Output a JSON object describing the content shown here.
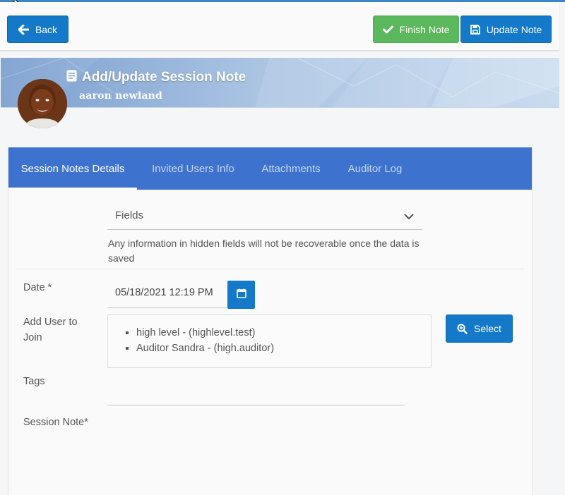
{
  "toolbar": {
    "back_label": "Back",
    "finish_label": "Finish Note",
    "update_label": "Update Note"
  },
  "header": {
    "title": "Add/Update Session Note",
    "client_name": "aaron newland"
  },
  "tabs": [
    {
      "label": "Session Notes Details",
      "active": true
    },
    {
      "label": "Invited Users Info",
      "active": false
    },
    {
      "label": "Attachments",
      "active": false
    },
    {
      "label": "Auditor Log",
      "active": false
    }
  ],
  "form": {
    "fields_select": "Fields",
    "warning": "Any information in hidden fields will not be recoverable once the data is saved",
    "date_label": "Date *",
    "date_value": "05/18/2021 12:19 PM",
    "add_user_label": "Add User to Join",
    "invited_users": [
      "high level - (highlevel.test)",
      "Auditor Sandra - (high.auditor)"
    ],
    "select_label": "Select",
    "tags_label": "Tags",
    "session_note_label": "Session Note*"
  },
  "colors": {
    "primary": "#1479c8",
    "success": "#5cb85c",
    "tab_bar": "#3d72cf"
  }
}
